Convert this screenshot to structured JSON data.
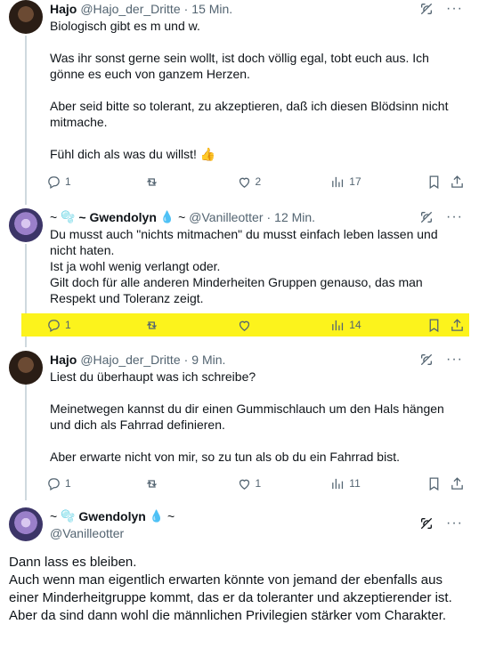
{
  "tweets": [
    {
      "name": "Hajo",
      "handle": "@Hajo_der_Dritte",
      "separator": "·",
      "time": "15 Min.",
      "paragraphs": [
        "Biologisch gibt es m und w.",
        "Was ihr sonst gerne sein wollt, ist doch völlig egal, tobt euch aus. Ich gönne es euch von ganzem Herzen.",
        "Aber seid bitte so tolerant, zu akzeptieren, daß ich diesen Blödsinn nicht mitmache.",
        "Fühl dich als was du willst!"
      ],
      "emoji": "👍",
      "replies": "1",
      "reposts": "",
      "likes": "2",
      "views": "17"
    },
    {
      "name_prefix": "~",
      "name_bubble": "🫧",
      "name": "~ Gwendolyn",
      "name_drop": "💧",
      "name_suffix": "~",
      "handle": "@Vanilleotter",
      "separator": "·",
      "time": "12 Min.",
      "lines": [
        "Du musst auch \"nichts mitmachen\" du musst einfach leben lassen und nicht haten.",
        "Ist ja wohl wenig verlangt oder.",
        "Gilt doch für alle anderen Minderheiten Gruppen genauso, das man Respekt und Toleranz zeigt."
      ],
      "replies": "1",
      "reposts": "",
      "likes": "",
      "views": "14"
    },
    {
      "name": "Hajo",
      "handle": "@Hajo_der_Dritte",
      "separator": "·",
      "time": "9 Min.",
      "paragraphs": [
        "Liest du überhaupt was ich schreibe?",
        "Meinetwegen kannst du dir einen Gummischlauch um den Hals hängen und dich als Fahrrad definieren.",
        "Aber erwarte nicht von mir, so zu tun als ob du ein Fahrrad bist."
      ],
      "replies": "1",
      "reposts": "",
      "likes": "1",
      "views": "11"
    },
    {
      "name_prefix": "~",
      "name_bubble": "🫧",
      "name": "Gwendolyn",
      "name_drop": "💧",
      "name_suffix": "~",
      "handle": "@Vanilleotter",
      "lines": [
        "Dann lass es bleiben.",
        "Auch wenn man eigentlich erwarten könnte von jemand der ebenfalls aus einer Minderheitgruppe kommt, das er da toleranter und akzeptierender ist.",
        "Aber da sind dann wohl die männlichen Privilegien stärker vom Charakter."
      ]
    }
  ],
  "icons": {
    "grok": "grok-icon",
    "more": "···",
    "reply": "reply-icon",
    "repost": "repost-icon",
    "like": "like-icon",
    "views": "views-icon",
    "bookmark": "bookmark-icon",
    "share": "share-icon"
  },
  "colors": {
    "highlight": "#fcf31c",
    "secondary_text": "#536471",
    "primary_text": "#0f1419",
    "thread_line": "#cfd9de"
  }
}
